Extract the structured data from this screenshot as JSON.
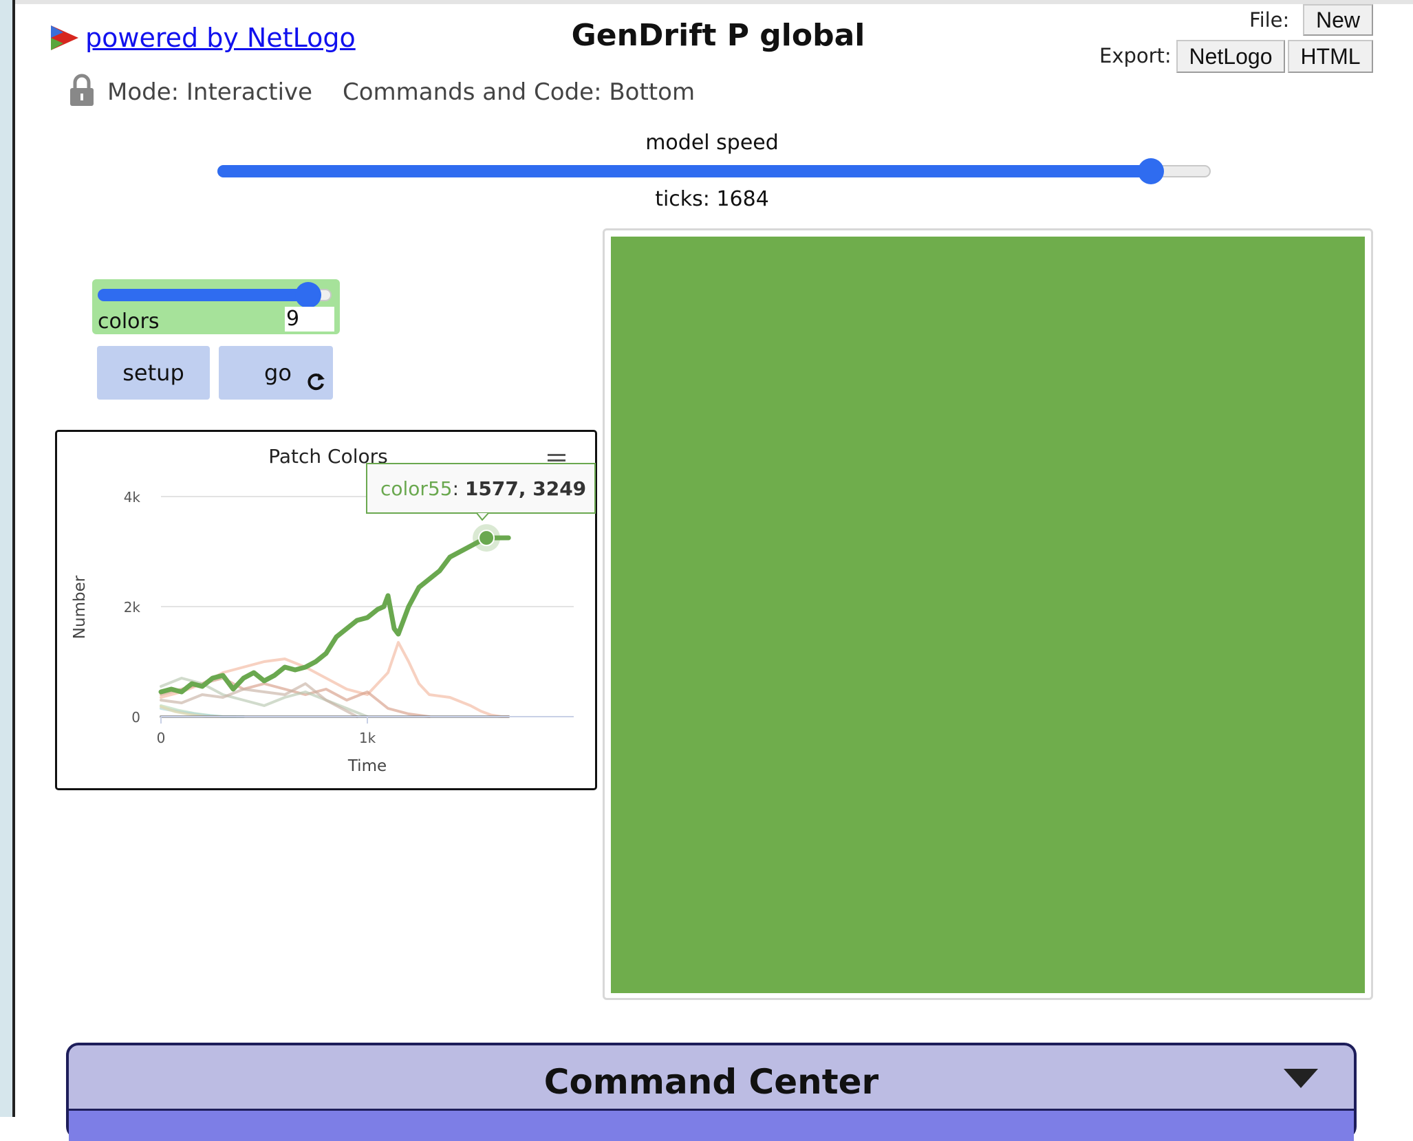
{
  "header": {
    "logo_text": " powered by NetLogo",
    "title": "GenDrift P global",
    "file_label": "File:",
    "new_label": "New",
    "export_label": "Export:",
    "export_netlogo_label": "NetLogo",
    "export_html_label": "HTML"
  },
  "status": {
    "mode": "Mode: Interactive",
    "commands": "Commands and Code: Bottom"
  },
  "speed": {
    "label": "model speed",
    "value_fraction": 0.94,
    "ticks": "ticks: 1684"
  },
  "widgets": {
    "colors_slider": {
      "label": "colors",
      "value": "9",
      "min": 0,
      "max": 10,
      "fraction": 0.9
    },
    "setup_label": "setup",
    "go_label": "go"
  },
  "plot": {
    "tooltip": {
      "series": "color55",
      "values": "1577, 3249"
    }
  },
  "chart_data": {
    "type": "line",
    "title": "Patch Colors",
    "xlabel": "Time",
    "ylabel": "Number",
    "xlim": [
      0,
      2000
    ],
    "ylim": [
      0,
      4000
    ],
    "x_ticks": [
      {
        "value": 0,
        "label": "0"
      },
      {
        "value": 1000,
        "label": "1k"
      }
    ],
    "y_ticks": [
      {
        "value": 0,
        "label": "0"
      },
      {
        "value": 2000,
        "label": "2k"
      },
      {
        "value": 4000,
        "label": "4k"
      }
    ],
    "grid": true,
    "series": [
      {
        "name": "color55",
        "color": "#6aa84f",
        "x": [
          0,
          50,
          100,
          150,
          200,
          250,
          300,
          350,
          400,
          450,
          500,
          550,
          600,
          650,
          700,
          750,
          800,
          850,
          900,
          950,
          1000,
          1050,
          1080,
          1100,
          1130,
          1150,
          1200,
          1250,
          1300,
          1350,
          1400,
          1450,
          1500,
          1550,
          1577,
          1684
        ],
        "y": [
          450,
          500,
          450,
          600,
          550,
          700,
          750,
          500,
          700,
          800,
          650,
          750,
          900,
          850,
          900,
          1000,
          1150,
          1450,
          1600,
          1750,
          1800,
          1950,
          2000,
          2200,
          1600,
          1500,
          2000,
          2350,
          2500,
          2650,
          2900,
          3000,
          3100,
          3200,
          3249,
          3250
        ]
      },
      {
        "color": "#f2b9a0",
        "x": [
          0,
          100,
          200,
          300,
          400,
          500,
          600,
          700,
          800,
          900,
          1000,
          1100,
          1150,
          1200,
          1250,
          1300,
          1400,
          1500,
          1550,
          1600,
          1650,
          1684
        ],
        "y": [
          350,
          450,
          600,
          800,
          900,
          1000,
          1050,
          900,
          700,
          500,
          400,
          800,
          1350,
          1000,
          600,
          400,
          350,
          200,
          100,
          30,
          0,
          0
        ]
      },
      {
        "color": "#d79e88",
        "x": [
          0,
          100,
          200,
          300,
          400,
          500,
          600,
          700,
          800,
          900,
          1000,
          1050,
          1100,
          1200,
          1300
        ],
        "y": [
          400,
          500,
          600,
          700,
          500,
          600,
          500,
          400,
          500,
          300,
          450,
          300,
          150,
          50,
          0
        ]
      },
      {
        "color": "#b9c7b0",
        "x": [
          0,
          100,
          200,
          300,
          400,
          500,
          600,
          700,
          800,
          900,
          1000
        ],
        "y": [
          550,
          700,
          600,
          400,
          300,
          200,
          350,
          450,
          300,
          150,
          0
        ]
      },
      {
        "color": "#c8b2a4",
        "x": [
          0,
          100,
          200,
          300,
          400,
          500,
          600,
          700,
          800,
          900,
          950
        ],
        "y": [
          300,
          250,
          400,
          350,
          500,
          450,
          400,
          600,
          300,
          100,
          0
        ]
      },
      {
        "color": "#b8d8b8",
        "x": [
          0,
          80,
          160,
          240,
          300,
          360
        ],
        "y": [
          200,
          120,
          60,
          20,
          0,
          0
        ]
      },
      {
        "color": "#a9d4d8",
        "x": [
          0,
          100,
          200,
          300,
          400
        ],
        "y": [
          150,
          80,
          30,
          0,
          0
        ]
      },
      {
        "color": "#e5d7a8",
        "x": [
          0,
          70,
          140,
          220,
          280
        ],
        "y": [
          180,
          90,
          40,
          0,
          0
        ]
      },
      {
        "color": "#777777",
        "x": [
          0,
          1684
        ],
        "y": [
          0,
          0
        ]
      }
    ]
  },
  "command_center": {
    "title": "Command Center"
  },
  "colors": {
    "accent_blue": "#2f6cf0",
    "view_green": "#6fad4c",
    "button_blue": "#c0cff0",
    "slider_green": "#a6e29a",
    "command_center_bg": "#bcbce3",
    "command_center_band": "#7d7ee6"
  }
}
